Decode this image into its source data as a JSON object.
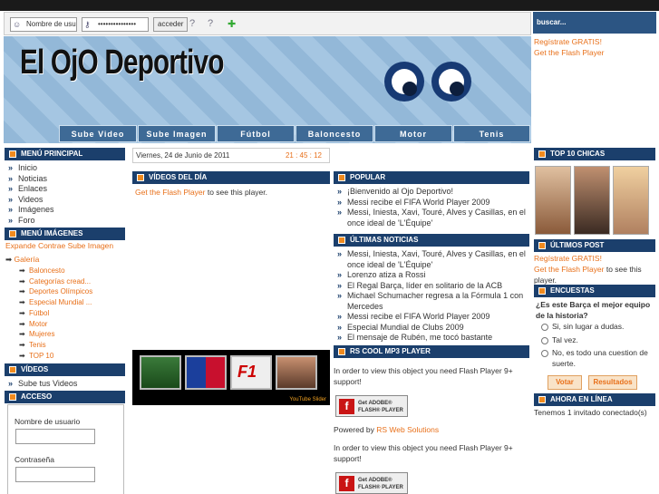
{
  "login": {
    "username_placeholder": "Nombre de usu",
    "password_value": "•••••••••••••••",
    "submit_label": "acceder"
  },
  "search": {
    "label": "buscar..."
  },
  "header": {
    "site_title": "El OjO Deportivo"
  },
  "nav": [
    "Sube Video",
    "Sube Imagen",
    "Fútbol",
    "Baloncesto",
    "Motor",
    "Tenis"
  ],
  "right_top": {
    "register": "Regístrate GRATIS!",
    "flash": "Get the Flash Player"
  },
  "main_menu": {
    "title": "MENÚ PRINCIPAL",
    "items": [
      "Inicio",
      "Noticias",
      "Enlaces",
      "Videos",
      "Imágenes",
      "Foro"
    ]
  },
  "image_menu": {
    "title": "MENÚ IMÁGENES",
    "controls": [
      "Expande",
      "Contrae",
      "Sube Imagen"
    ],
    "root": "Galería",
    "items": [
      "Baloncesto",
      "Categorías cread...",
      "Deportes Olímpicos",
      "Especial Mundial ...",
      "Fútbol",
      "Motor",
      "Mujeres",
      "Tenis",
      "TOP 10"
    ]
  },
  "videos_menu": {
    "title": "VÍDEOS",
    "items": [
      "Sube tus Videos"
    ]
  },
  "access": {
    "title": "ACCESO",
    "username_label": "Nombre de usuario",
    "password_label": "Contraseña"
  },
  "date": {
    "text": "Viernes, 24 de Junio de 2011",
    "clock": "21 : 45 : 12"
  },
  "videos_day": {
    "title": "VÍDEOS DEL DÍA",
    "flash_link": "Get the Flash Player",
    "flash_text": " to see this player.",
    "slider_label": "YouTube Slider"
  },
  "popular": {
    "title": "POPULAR",
    "items": [
      "¡Bienvenido al Ojo Deportivo!",
      "Messi recibe el FIFA World Player 2009",
      "Messi, Iniesta, Xavi, Touré, Alves y Casillas, en el once ideal de 'L'Équipe'"
    ]
  },
  "latest_news": {
    "title": "ÚLTIMAS NOTICIAS",
    "items": [
      "Messi, Iniesta, Xavi, Touré, Alves y Casillas, en el once ideal de 'L'Équipe'",
      "Lorenzo atiza a Rossi",
      "El Regal Barça, líder en solitario de la ACB",
      "Michael Schumacher regresa a la Fórmula 1 con Mercedes",
      "Messi recibe el FIFA World Player 2009",
      "Especial Mundial de Clubs 2009",
      "El mensaje de Rubén, me tocó bastante"
    ]
  },
  "mp3": {
    "title": "RS COOL MP3 PLAYER",
    "flash_notice": "In order to view this object you need Flash Player 9+ support!",
    "flash_button_line1": "Get ADOBE®",
    "flash_button_line2": "FLASH® PLAYER",
    "powered_prefix": "Powered by ",
    "powered_link": "RS Web Solutions",
    "flash_notice_2": "In order to view this object you need Flash Player 9+ support!"
  },
  "top10": {
    "title": "TOP 10 CHICAS"
  },
  "last_posts": {
    "title": "ÚLTIMOS POST",
    "register": "Regístrate GRATIS!",
    "flash_link": "Get the Flash Player",
    "flash_text": " to see this player."
  },
  "poll": {
    "title": "ENCUESTAS",
    "question": "¿Es este Barça el mejor equipo de la historia?",
    "options": [
      "Si, sin lugar a dudas.",
      "Tal vez.",
      "No, es todo una cuestion de suerte."
    ],
    "vote": "Votar",
    "results": "Resultados"
  },
  "online": {
    "title": "AHORA EN LÍNEA",
    "text": "Tenemos 1 invitado conectado(s)"
  },
  "colors": {
    "header_blue": "#1b3f6c",
    "accent_orange": "#e8701a",
    "banner_blue": "#93b8d8"
  }
}
